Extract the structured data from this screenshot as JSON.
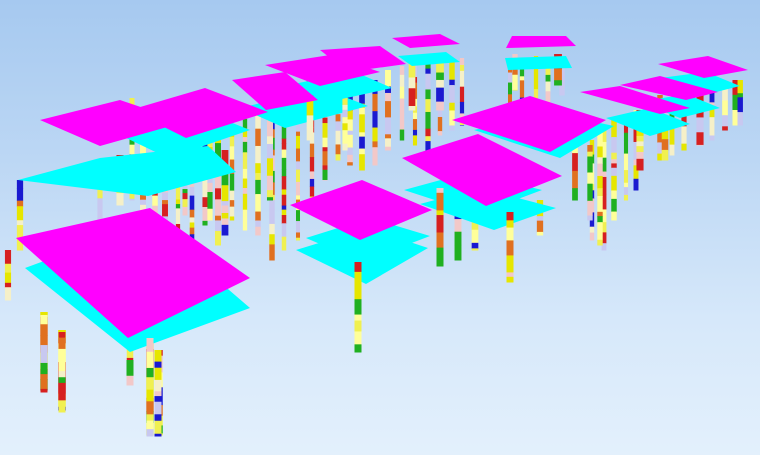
{
  "viewer": {
    "background_top": "#a6c9f0",
    "background_bottom": "#e3f0fc"
  },
  "palette": {
    "top_slab": "#ff00ff",
    "lower_slab": "#00ffff",
    "borehole_colors": [
      "#e6e600",
      "#f0f050",
      "#ffff99",
      "#e07020",
      "#d62020",
      "#20b020",
      "#1a1ad0",
      "#f2c8c8",
      "#f5f0c8",
      "#c8c8f0"
    ]
  }
}
